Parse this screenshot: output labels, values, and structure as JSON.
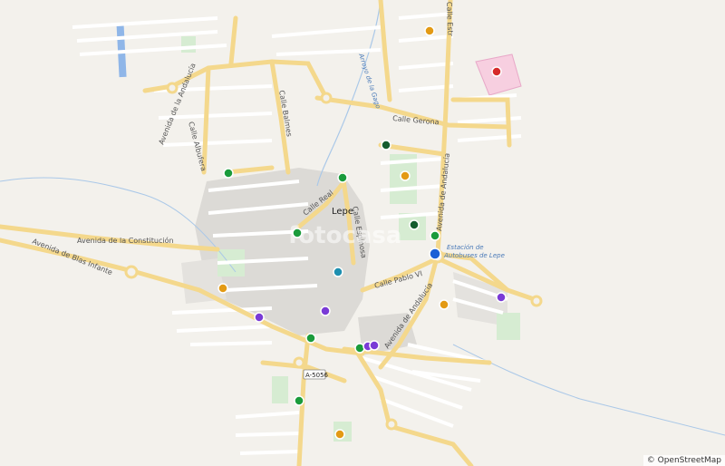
{
  "map": {
    "town": "Lepe",
    "watermark": "fotocasa",
    "attribution": "© OpenStreetMap",
    "road_shield": "A-5056",
    "bus_station": "Estación de Autobuses de Lepe",
    "bus_station_line1": "Estación de",
    "bus_station_line2": "Autobuses de Lepe",
    "water_label": "Arroyo de la Gago",
    "streets": {
      "constitucion": "Avenida de la Constitución",
      "blas_infante": "Avenida de Blas Infante",
      "andalucia_north": "Avenida de Andalucía",
      "andalucia_south": "Avenida de Andalucía",
      "gerona": "Calle Gerona",
      "balmes": "Calle Balmes",
      "real": "Calle Real",
      "pablo_vi": "Calle Pablo VI",
      "espinosa": "Calle Espinosa",
      "estr": "Calle Estr",
      "albufera": "Calle Albufera",
      "andalucia_nw": "Avenida de la Andalucía"
    },
    "marker_colors": {
      "green": "#1a9b3b",
      "dark_green": "#145c2e",
      "orange": "#e39a14",
      "purple": "#7a3bd6",
      "teal": "#1e8fb0",
      "blue": "#1a5fd6",
      "red": "#d62a2a"
    }
  }
}
